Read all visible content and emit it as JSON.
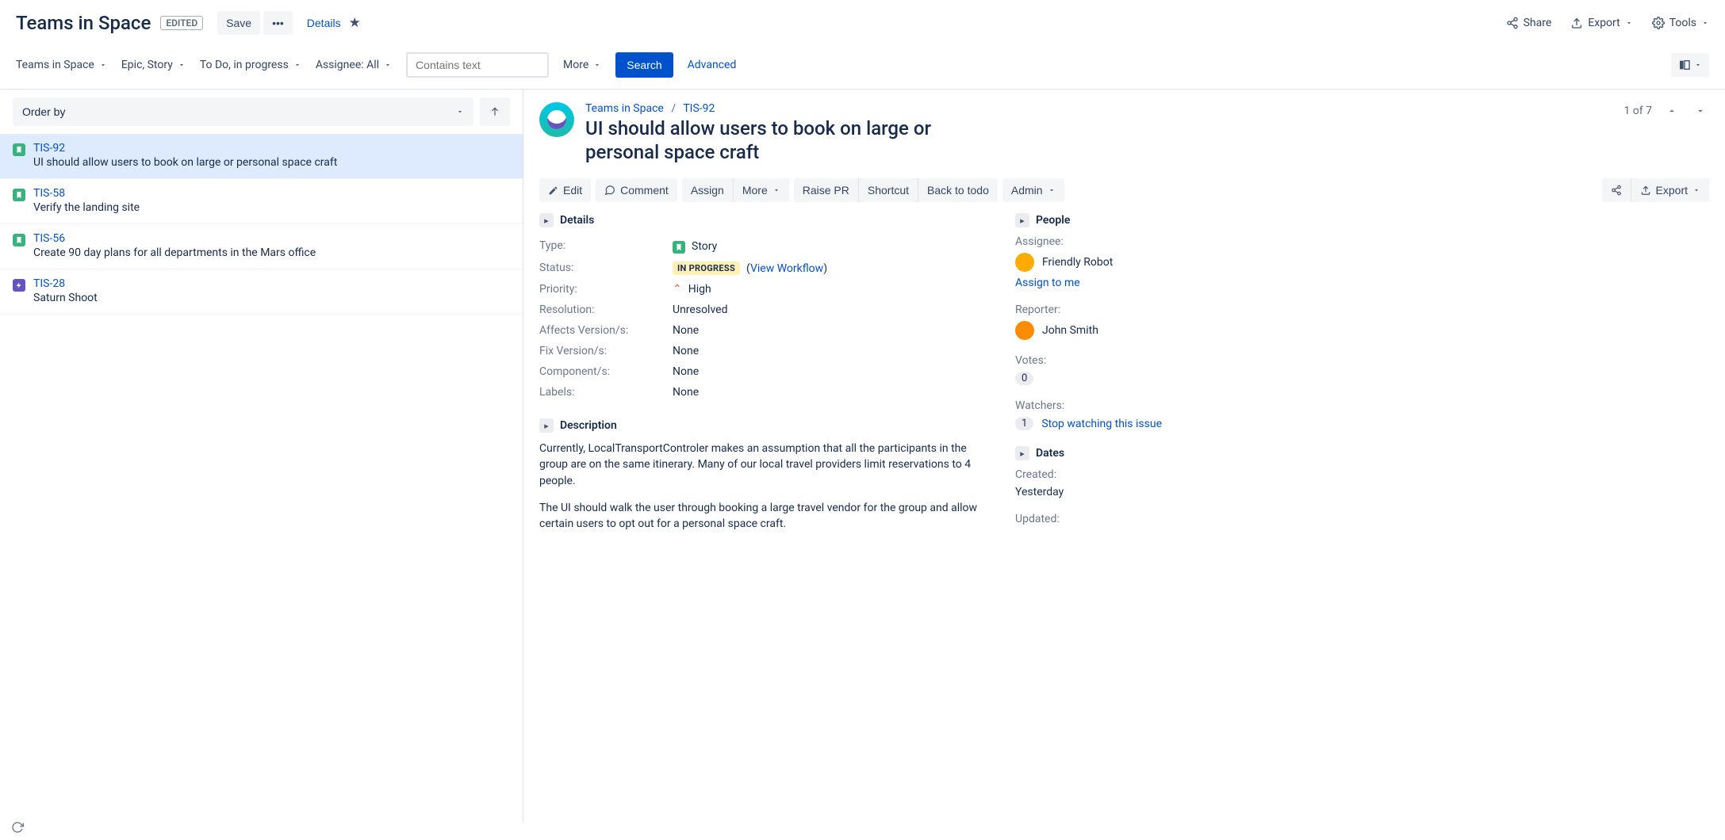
{
  "header": {
    "title": "Teams in Space",
    "edited_badge": "EDITED",
    "save": "Save",
    "details": "Details",
    "share": "Share",
    "export": "Export",
    "tools": "Tools"
  },
  "filters": {
    "project": "Teams in Space",
    "types": "Epic, Story",
    "statuses": "To Do, in progress",
    "assignee": "Assignee: All",
    "search_placeholder": "Contains text",
    "more": "More",
    "search_btn": "Search",
    "advanced": "Advanced"
  },
  "list": {
    "order_by": "Order by",
    "items": [
      {
        "key": "TIS-92",
        "type": "story",
        "summary": "UI should allow users to book on large or personal space craft"
      },
      {
        "key": "TIS-58",
        "type": "story",
        "summary": "Verify the landing site"
      },
      {
        "key": "TIS-56",
        "type": "story",
        "summary": "Create 90 day plans for all departments in the Mars office"
      },
      {
        "key": "TIS-28",
        "type": "epic",
        "summary": "Saturn Shoot"
      }
    ],
    "selected_key": "TIS-92"
  },
  "issue": {
    "breadcrumb_project": "Teams in Space",
    "breadcrumb_key": "TIS-92",
    "title": "UI should allow users to book on large or personal space craft",
    "pager": "1 of 7",
    "actions": {
      "edit": "Edit",
      "comment": "Comment",
      "assign": "Assign",
      "more": "More",
      "raise_pr": "Raise PR",
      "shortcut": "Shortcut",
      "back_to_todo": "Back to todo",
      "admin": "Admin",
      "export": "Export"
    },
    "sections": {
      "details": "Details",
      "description": "Description",
      "people": "People",
      "dates": "Dates"
    },
    "details": {
      "type_label": "Type:",
      "type_value": "Story",
      "status_label": "Status:",
      "status_value": "IN PROGRESS",
      "view_workflow": "View Workflow",
      "priority_label": "Priority:",
      "priority_value": "High",
      "resolution_label": "Resolution:",
      "resolution_value": "Unresolved",
      "affects_label": "Affects Version/s:",
      "affects_value": "None",
      "fix_label": "Fix Version/s:",
      "fix_value": "None",
      "components_label": "Component/s:",
      "components_value": "None",
      "labels_label": "Labels:",
      "labels_value": "None"
    },
    "description": {
      "p1": "Currently, LocalTransportControler makes an assumption that all the participants in the group are on the same itinerary. Many of our local travel providers limit reservations to 4 people.",
      "p2": "The UI should walk the user through booking a large travel vendor for the group and allow certain users to opt out for a personal space craft."
    },
    "people": {
      "assignee_label": "Assignee:",
      "assignee_value": "Friendly Robot",
      "assign_to_me": "Assign to me",
      "reporter_label": "Reporter:",
      "reporter_value": "John Smith",
      "votes_label": "Votes:",
      "votes_count": "0",
      "watchers_label": "Watchers:",
      "watchers_count": "1",
      "stop_watching": "Stop watching this issue"
    },
    "dates": {
      "created_label": "Created:",
      "created_value": "Yesterday",
      "updated_label": "Updated:"
    }
  }
}
